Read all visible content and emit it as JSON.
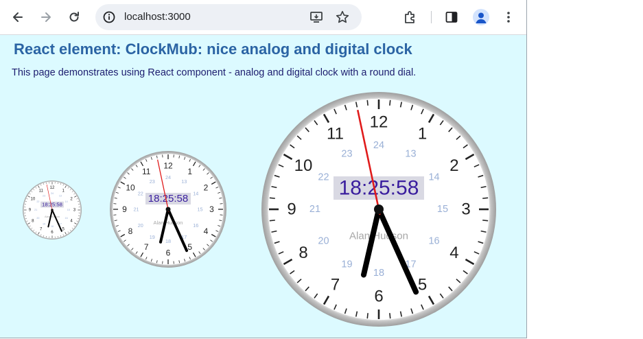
{
  "browser": {
    "url": "localhost:3000",
    "icons": {
      "back": "arrow-left-icon",
      "forward": "arrow-right-icon",
      "reload": "reload-icon",
      "site_info": "info-icon",
      "install": "install-app-icon",
      "bookmark": "star-icon",
      "extensions": "puzzle-icon",
      "side_panel": "side-panel-icon",
      "profile": "avatar",
      "menu": "kebab-menu-icon"
    }
  },
  "page": {
    "title": "React element: ClockMub: nice analog and digital clock",
    "description": "This page demonstrates using React component - analog and digital clock with a round dial.",
    "background_color": "#dcfaff",
    "title_color": "#2b64a4"
  },
  "clock": {
    "time": "18:25:58",
    "owner_label": "Alan Hudson",
    "hours_outer": [
      "12",
      "1",
      "2",
      "3",
      "4",
      "5",
      "6",
      "7",
      "8",
      "9",
      "10",
      "11"
    ],
    "hours_inner": [
      "24",
      "13",
      "14",
      "15",
      "16",
      "17",
      "18",
      "19",
      "20",
      "21",
      "22",
      "23"
    ],
    "hand_hour": 18,
    "hand_minute": 25,
    "hand_second": 58,
    "colors": {
      "second_hand": "#e01b1b",
      "hands": "#000000",
      "digital_text": "#3a1e9e",
      "digital_bg": "#d9d9e3",
      "inner_numbers": "#9ab0d6",
      "rim": "#c9c9c9"
    },
    "instances": [
      "small",
      "medium",
      "large"
    ]
  }
}
